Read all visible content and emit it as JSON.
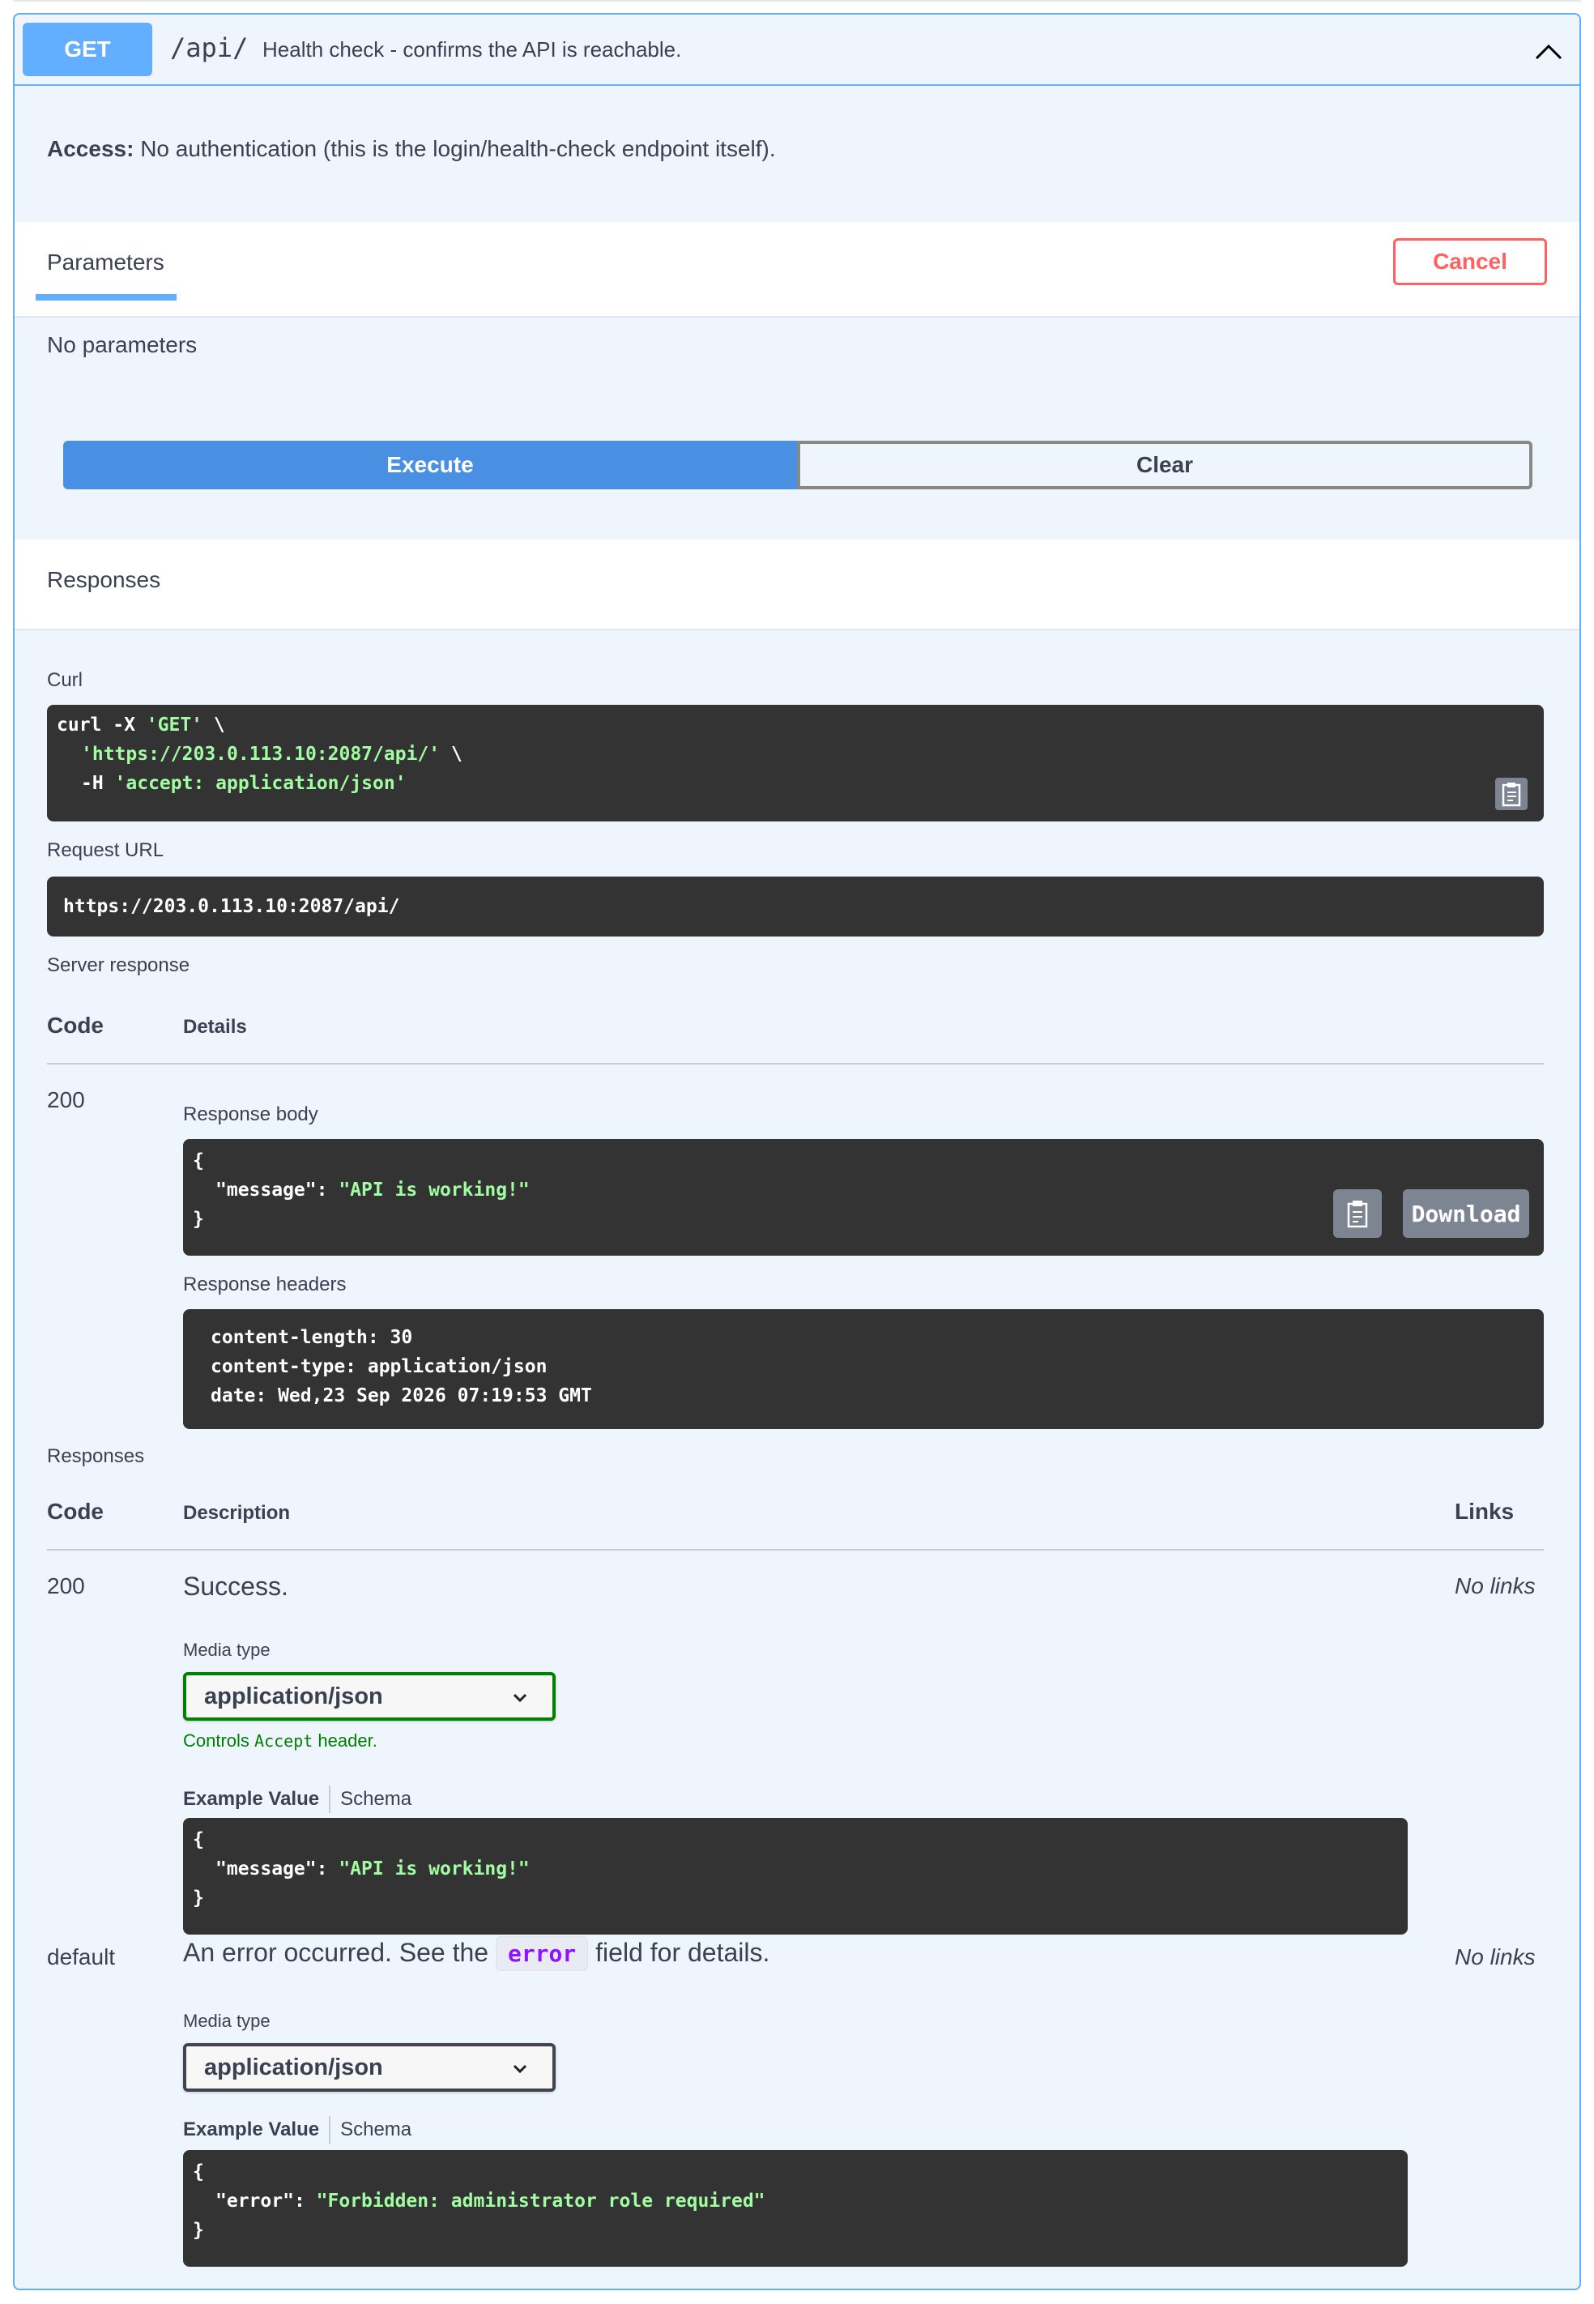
{
  "colors": {
    "accent": "#61affe",
    "execute": "#4990e2",
    "cancel": "#ff6060",
    "code_bg": "#333333",
    "string": "#a2fca2",
    "success_green": "#008000"
  },
  "summary": {
    "method": "GET",
    "path": "/api/",
    "description": "Health check - confirms the API is reachable.",
    "collapse_icon": "chevron-up-icon"
  },
  "access": {
    "label": "Access:",
    "text": "No authentication (this is the login/health-check endpoint itself)."
  },
  "parameters": {
    "tab": "Parameters",
    "cancel": "Cancel",
    "empty": "No parameters"
  },
  "actions": {
    "execute": "Execute",
    "clear": "Clear"
  },
  "responses_title": "Responses",
  "curl": {
    "label": "Curl",
    "line1_cmd": "curl -X ",
    "line1_str": "'GET'",
    "line1_tail": " \\",
    "line2_str": "'https://203.0.113.10:2087/api/'",
    "line2_tail": " \\",
    "line3_cmd": "-H ",
    "line3_str": "'accept: application/json'",
    "copy_icon": "clipboard-icon"
  },
  "request_url": {
    "label": "Request URL",
    "value": "https://203.0.113.10:2087/api/"
  },
  "server_response": {
    "label": "Server response",
    "col_code": "Code",
    "col_details": "Details",
    "code": "200",
    "body_label": "Response body",
    "body_open": "{",
    "body_key": "\"message\"",
    "body_colon": ": ",
    "body_value": "\"API is working!\"",
    "body_close": "}",
    "download": "Download",
    "headers_label": "Response headers",
    "headers": [
      "content-length: 30",
      "content-type: application/json",
      "date: Wed,23 Sep 2026 07:19:53 GMT"
    ]
  },
  "responses": {
    "label": "Responses",
    "col_code": "Code",
    "col_description": "Description",
    "col_links": "Links",
    "rows": [
      {
        "code": "200",
        "description": "Success.",
        "links": "No links",
        "media_label": "Media type",
        "media_value": "application/json",
        "controls_pre": "Controls ",
        "controls_code": "Accept",
        "controls_post": " header.",
        "tab_example": "Example Value",
        "tab_schema": "Schema",
        "ex_open": "{",
        "ex_key": "\"message\"",
        "ex_colon": ": ",
        "ex_value": "\"API is working!\"",
        "ex_close": "}"
      },
      {
        "code": "default",
        "description_pre": "An error occurred. See the ",
        "description_code": "error",
        "description_post": " field for details.",
        "links": "No links",
        "media_label": "Media type",
        "media_value": "application/json",
        "tab_example": "Example Value",
        "tab_schema": "Schema",
        "ex_open": "{",
        "ex_key": "\"error\"",
        "ex_colon": ": ",
        "ex_value": "\"Forbidden: administrator role required\"",
        "ex_close": "}"
      }
    ]
  }
}
